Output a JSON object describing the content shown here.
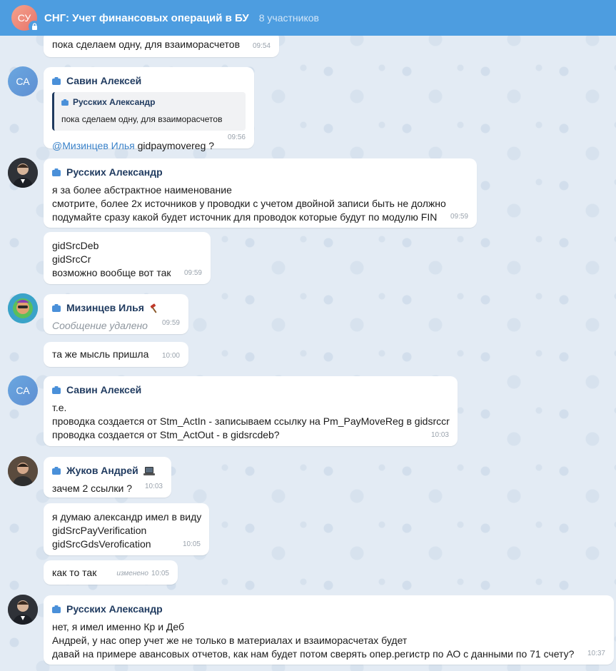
{
  "header": {
    "avatar_initials": "СУ",
    "title": "СНГ: Учет финансовых операций в БУ",
    "members": "8 участников"
  },
  "messages": [
    {
      "id": "m0",
      "lines": [
        "пока сделаем одну, для взаиморасчетов"
      ],
      "time": "09:54"
    },
    {
      "id": "m1",
      "avatar": "СА",
      "sender": "Савин Алексей",
      "reply_author": "Русских Александр",
      "reply_text": "пока сделаем одну, для взаиморасчетов",
      "mention": "@Мизинцев Илья",
      "text": " gidpaymovereg ?",
      "time": "09:56"
    },
    {
      "id": "m2",
      "sender": "Русских Александр",
      "lines": [
        "я за более абстрактное наименование",
        "смотрите, более 2х источников у проводки с учетом двойной записи быть не должно",
        "подумайте сразу какой будет источник для проводок которые будут по модулю FIN"
      ],
      "time": "09:59"
    },
    {
      "id": "m3",
      "lines": [
        "gidSrcDeb",
        "gidSrcCr",
        "возможно вообще вот так"
      ],
      "time": "09:59"
    },
    {
      "id": "m4",
      "sender": "Мизинцев Илья",
      "sender_emoji": "hammer-icon",
      "deleted_text": "Сообщение удалено",
      "time": "09:59"
    },
    {
      "id": "m5",
      "lines": [
        "та же мысль пришла"
      ],
      "time": "10:00"
    },
    {
      "id": "m6",
      "avatar": "СА",
      "sender": "Савин Алексей",
      "lines": [
        "т.е.",
        "проводка создается от Stm_ActIn - записываем ссылку на Pm_PayMoveReg в gidsrccr",
        "проводка создается от Stm_ActOut - в gidsrcdeb?"
      ],
      "time": "10:03"
    },
    {
      "id": "m7",
      "sender": "Жуков Андрей",
      "sender_emoji": "laptop-icon",
      "lines": [
        "зачем 2 ссылки ?"
      ],
      "time": "10:03"
    },
    {
      "id": "m8",
      "lines": [
        "я думаю александр имел в виду",
        "gidSrcPayVerification",
        "gidSrcGdsVerofication"
      ],
      "time": "10:05"
    },
    {
      "id": "m9",
      "lines": [
        "как то так"
      ],
      "edited": "изменено",
      "time": "10:05"
    },
    {
      "id": "m10",
      "sender": "Русских Александр",
      "lines": [
        "нет, я имел именно Кр и Деб",
        "Андрей, у нас опер учет же не только в материалах и взаиморасчетах будет",
        "давай на примере авансовых отчетов, как нам будет потом сверять опер.регистр по АО с данными по 71 счету?"
      ],
      "time": "10:37"
    }
  ],
  "colors": {
    "header": "#4d9de0",
    "sender": "#1f3a5f",
    "mention": "#3a82c9",
    "background": "#e3ebf4"
  }
}
